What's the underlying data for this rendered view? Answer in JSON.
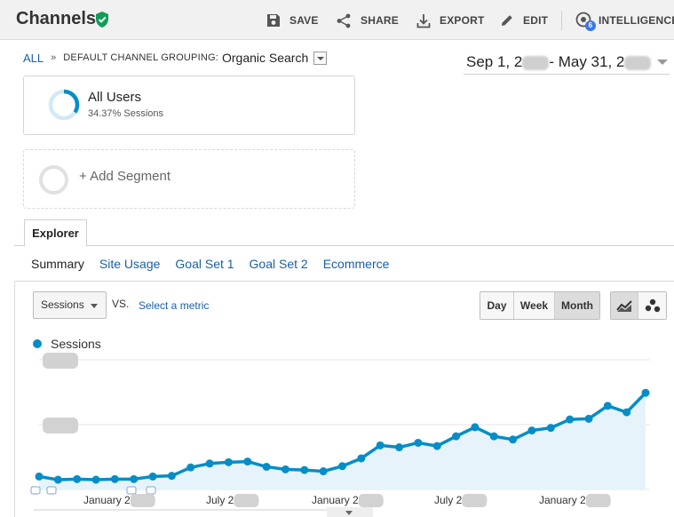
{
  "header": {
    "title": "Channels",
    "save": "SAVE",
    "share": "SHARE",
    "export": "EXPORT",
    "edit": "EDIT",
    "intelligence": "INTELLIGENCE",
    "intelligence_badge": "6"
  },
  "breadcrumb": {
    "all": "ALL",
    "separator": "»",
    "grouping": "DEFAULT CHANNEL GROUPING:",
    "dimension": "Organic Search"
  },
  "date_range": {
    "start": "Sep 1, 2",
    "middle": "- May 31, 2"
  },
  "segments": {
    "active_name": "All Users",
    "active_detail": "34.37% Sessions",
    "add_label": "+ Add Segment"
  },
  "tabs": {
    "explorer": "Explorer",
    "subnav": [
      "Summary",
      "Site Usage",
      "Goal Set 1",
      "Goal Set 2",
      "Ecommerce"
    ]
  },
  "controls": {
    "metric": "Sessions",
    "vs": "VS.",
    "select_metric": "Select a metric",
    "granularity": [
      "Day",
      "Week",
      "Month"
    ],
    "selected_granularity": "Month"
  },
  "colors": {
    "accent": "#058dc7",
    "fill": "#e6f3fa",
    "link": "#1a5fa8"
  },
  "chart_data": {
    "type": "area",
    "legend": "Sessions",
    "x_tick_labels": [
      "January 2",
      "July 2",
      "January 2",
      "July 2",
      "January 2"
    ],
    "series": [
      {
        "name": "Sessions",
        "values": [
          20,
          15,
          16,
          15,
          16,
          16,
          20,
          21,
          34,
          40,
          42,
          43,
          35,
          31,
          30,
          28,
          36,
          48,
          68,
          65,
          72,
          67,
          82,
          96,
          82,
          77,
          91,
          95,
          108,
          109,
          129,
          119,
          149
        ]
      }
    ],
    "ylim": [
      0,
      200
    ],
    "grid": true
  }
}
